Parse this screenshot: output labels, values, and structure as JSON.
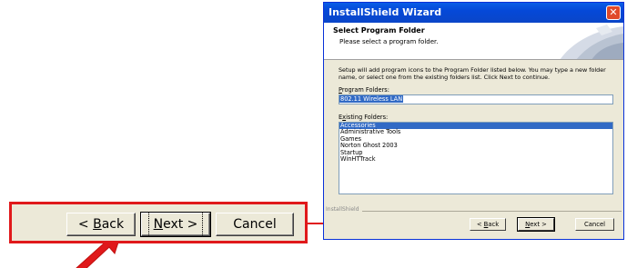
{
  "callout": {
    "back_prefix": "< ",
    "back_mnemonic": "B",
    "back_rest": "ack",
    "next_mnemonic": "N",
    "next_rest": "ext >",
    "cancel_label": "Cancel"
  },
  "dialog": {
    "title": "InstallShield Wizard",
    "close_glyph": "✕",
    "header_title": "Select Program Folder",
    "header_subtitle": "Please select a program folder.",
    "instructions": "Setup will add program icons to the Program Folder listed below.  You may type a new folder name, or select one from the existing folders list.  Click Next to continue.",
    "program_folders_label_mn": "P",
    "program_folders_label_rest": "rogram Folders:",
    "program_folder_value": "802.11 Wireless LAN",
    "existing_label_pre": "E",
    "existing_label_mn": "x",
    "existing_label_rest": "isting Folders:",
    "existing_folders": [
      "Accessories",
      "Administrative Tools",
      "Games",
      "Norton Ghost 2003",
      "Startup",
      "WinHTTrack"
    ],
    "selected_folder": "Accessories",
    "group_label": "InstallShield",
    "back_prefix": "< ",
    "back_mnemonic": "B",
    "back_rest": "ack",
    "next_mnemonic": "N",
    "next_rest": "ext >",
    "cancel_label": "Cancel"
  },
  "colors": {
    "callout_border": "#e0191b",
    "arrow": "#e0191b",
    "titlebar": "#0548d8",
    "selection": "#316ac5"
  }
}
